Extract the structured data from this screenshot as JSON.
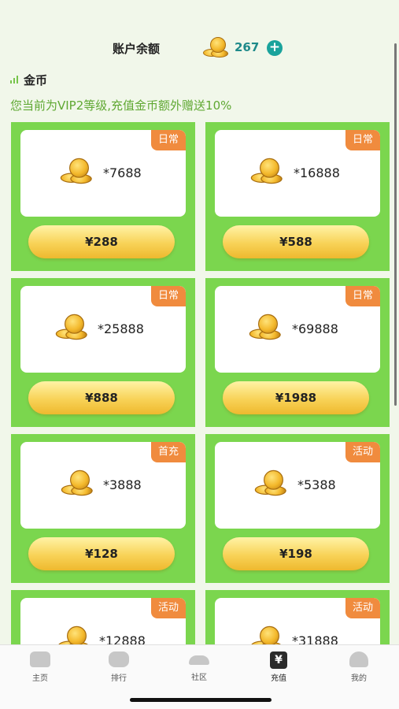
{
  "header": {
    "title": "账户余额",
    "balance": "267",
    "add_label": "+"
  },
  "section": {
    "title": "金币",
    "vip_note": "您当前为VIP2等级,充值金币额外赠送10%"
  },
  "cards": [
    {
      "tag": "日常",
      "amount": "*7688",
      "price": "¥288"
    },
    {
      "tag": "日常",
      "amount": "*16888",
      "price": "¥588"
    },
    {
      "tag": "日常",
      "amount": "*25888",
      "price": "¥888"
    },
    {
      "tag": "日常",
      "amount": "*69888",
      "price": "¥1988"
    },
    {
      "tag": "首充",
      "amount": "*3888",
      "price": "¥128"
    },
    {
      "tag": "活动",
      "amount": "*5388",
      "price": "¥198"
    },
    {
      "tag": "活动",
      "amount": "*12888",
      "price": ""
    },
    {
      "tag": "活动",
      "amount": "*31888",
      "price": ""
    }
  ],
  "tabs": [
    {
      "label": "主页",
      "icon": "home-icon"
    },
    {
      "label": "排行",
      "icon": "ranking-icon"
    },
    {
      "label": "社区",
      "icon": "community-icon"
    },
    {
      "label": "充值",
      "icon": "recharge-icon",
      "active": true
    },
    {
      "label": "我的",
      "icon": "profile-icon"
    }
  ],
  "colors": {
    "accent_green": "#7bd64e",
    "tag_orange": "#f08b3e",
    "balance_teal": "#1f8a8a",
    "note_green": "#5fa832"
  }
}
